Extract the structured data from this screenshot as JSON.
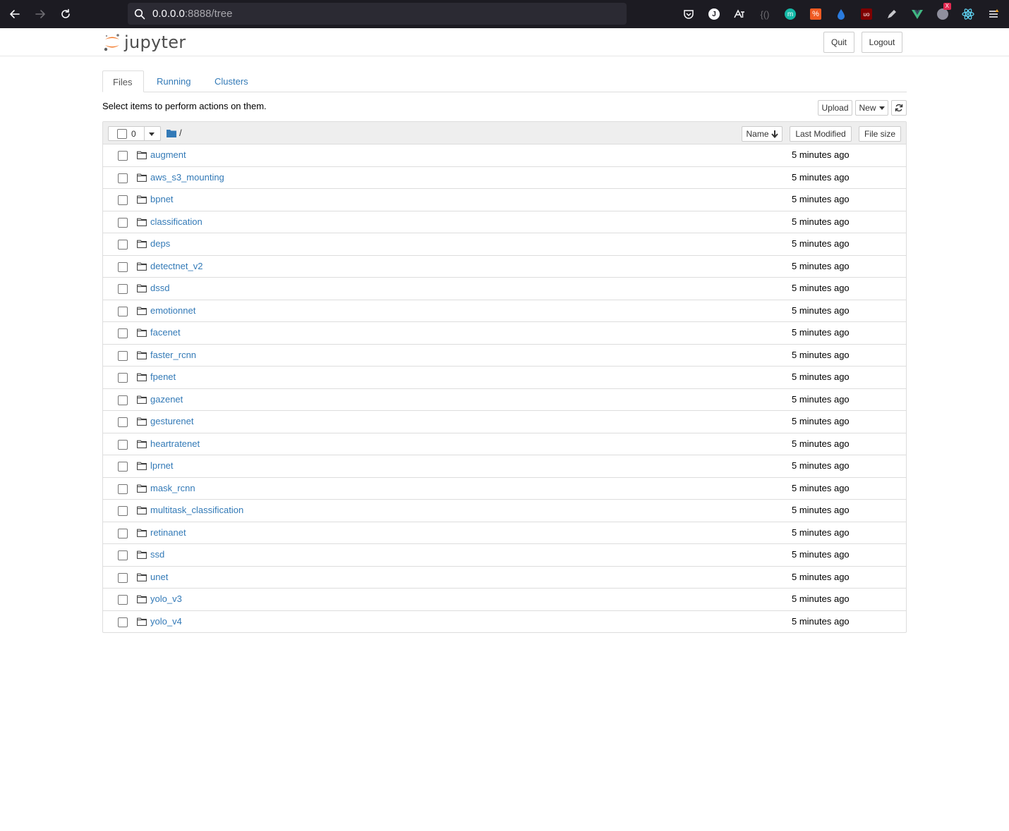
{
  "browser": {
    "url_host": "0.0.0.0",
    "url_rest": ":8888/tree",
    "extension_badge": "X"
  },
  "header": {
    "logo_text": "jupyter",
    "quit_label": "Quit",
    "logout_label": "Logout"
  },
  "tabs": [
    {
      "label": "Files",
      "active": true
    },
    {
      "label": "Running",
      "active": false
    },
    {
      "label": "Clusters",
      "active": false
    }
  ],
  "toolbar": {
    "hint": "Select items to perform actions on them.",
    "upload_label": "Upload",
    "new_label": "New"
  },
  "list_header": {
    "selected_count": "0",
    "path": "/",
    "name_label": "Name",
    "last_modified_label": "Last Modified",
    "file_size_label": "File size"
  },
  "files": [
    {
      "name": "augment",
      "modified": "5 minutes ago"
    },
    {
      "name": "aws_s3_mounting",
      "modified": "5 minutes ago"
    },
    {
      "name": "bpnet",
      "modified": "5 minutes ago"
    },
    {
      "name": "classification",
      "modified": "5 minutes ago"
    },
    {
      "name": "deps",
      "modified": "5 minutes ago"
    },
    {
      "name": "detectnet_v2",
      "modified": "5 minutes ago"
    },
    {
      "name": "dssd",
      "modified": "5 minutes ago"
    },
    {
      "name": "emotionnet",
      "modified": "5 minutes ago"
    },
    {
      "name": "facenet",
      "modified": "5 minutes ago"
    },
    {
      "name": "faster_rcnn",
      "modified": "5 minutes ago"
    },
    {
      "name": "fpenet",
      "modified": "5 minutes ago"
    },
    {
      "name": "gazenet",
      "modified": "5 minutes ago"
    },
    {
      "name": "gesturenet",
      "modified": "5 minutes ago"
    },
    {
      "name": "heartratenet",
      "modified": "5 minutes ago"
    },
    {
      "name": "lprnet",
      "modified": "5 minutes ago"
    },
    {
      "name": "mask_rcnn",
      "modified": "5 minutes ago"
    },
    {
      "name": "multitask_classification",
      "modified": "5 minutes ago"
    },
    {
      "name": "retinanet",
      "modified": "5 minutes ago"
    },
    {
      "name": "ssd",
      "modified": "5 minutes ago"
    },
    {
      "name": "unet",
      "modified": "5 minutes ago"
    },
    {
      "name": "yolo_v3",
      "modified": "5 minutes ago"
    },
    {
      "name": "yolo_v4",
      "modified": "5 minutes ago"
    }
  ],
  "colors": {
    "link": "#337ab7",
    "browser_bg": "#1c1b22",
    "jupyter_orange": "#f37726"
  }
}
